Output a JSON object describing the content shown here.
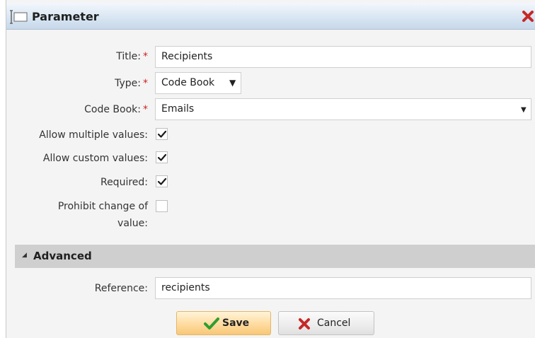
{
  "dialog": {
    "title": "Parameter",
    "title_icon": "window-icon",
    "close_icon": "close-icon"
  },
  "form": {
    "title_label": "Title:",
    "title_value": "Recipients",
    "type_label": "Type:",
    "type_value": "Code Book",
    "code_book_label": "Code Book:",
    "code_book_value": "Emails",
    "required_marker": "*",
    "allow_multiple_label": "Allow multiple values:",
    "allow_multiple_checked": true,
    "allow_custom_label": "Allow custom values:",
    "allow_custom_checked": true,
    "required_label": "Required:",
    "required_checked": true,
    "prohibit_change_label_line1": "Prohibit change of",
    "prohibit_change_label_line2": "value:",
    "prohibit_change_checked": false
  },
  "advanced": {
    "header": "Advanced",
    "reference_label": "Reference:",
    "reference_value": "recipients"
  },
  "buttons": {
    "save": "Save",
    "cancel": "Cancel"
  },
  "colors": {
    "required": "#d21f1f",
    "save_check": "#2e9e2e",
    "cancel_x": "#c62828"
  }
}
